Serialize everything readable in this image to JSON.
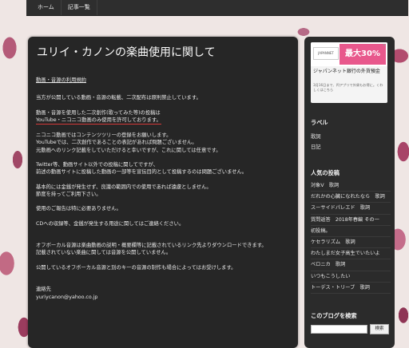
{
  "nav": {
    "items": [
      "ホーム",
      "記事一覧"
    ]
  },
  "post": {
    "title": "ユリイ・カノンの楽曲使用に関して",
    "section_heading": "動画・音源の利用規約",
    "lines": [
      "当方が公開している動画・音源の転載、二次配布は原則禁止しています。",
      "",
      "動画・音源を使用した二次創作(歌ってみた等)の投稿は",
      "YouTube・ニコニコ動画のみ使用を許可しております。",
      "",
      "ニコニコ動画ではコンテンツツリーの登録をお願いします。",
      "YouTubeでは、二次創作であることの表記があれば問題ございません。",
      "元動画へのリンク記載をしていただけると幸いですが、これに関しては任意です。",
      "",
      "Twitter等、動画サイト以外での投稿に関してですが、",
      "前述の動画サイトに投稿した動画の一部等を宣伝目的として投稿するのは問題ございません。",
      "",
      "基本的には金銭が発生せず、良識の範囲内での使用であれば遠慮としません。",
      "節度を持ってご利用下さい。",
      "",
      "使用のご報告は特に必要ありません。",
      "",
      "CDへの収録等、金銭が発生する用途に関してはご連絡ください。",
      "",
      "",
      "オフボーカル音源は楽曲動画の説明・概要欄等に記載されているリンク先よりダウンロードできます。",
      "記載されていない楽曲に関しては音源を公開していません。",
      "",
      "公開しているオフボーカル音源と別のキーの音源の制作も場合によってはお受けします。",
      "",
      "",
      "連絡先",
      "yuriycanon@yahoo.co.jp"
    ]
  },
  "sidebar": {
    "ad": {
      "logo": "JAPANNET",
      "banner": "最大30%",
      "title": "ジャパンネット銀行の外貨預金",
      "sub": "3月16日まで、円アプリで外貨もお得に。くわしくはこちら"
    },
    "labels_title": "ラベル",
    "labels": [
      "歌詞",
      "日記"
    ],
    "popular_title": "人気の投稿",
    "popular": [
      "対象V　歌詞",
      "だれかの心臓になれたなら　歌詞",
      "スーサイドパレエド　歌詞",
      "質問返答　2018年春編 その一",
      "初投稿。",
      "ケセラリズム　歌詞",
      "わたしまだ女子高生でいたいよ",
      "ベロニカ　歌詞",
      "いつもこうしたい",
      "トーデス・トリーブ　歌詞"
    ],
    "search_title": "このブログを検索",
    "search_button": "検索"
  }
}
